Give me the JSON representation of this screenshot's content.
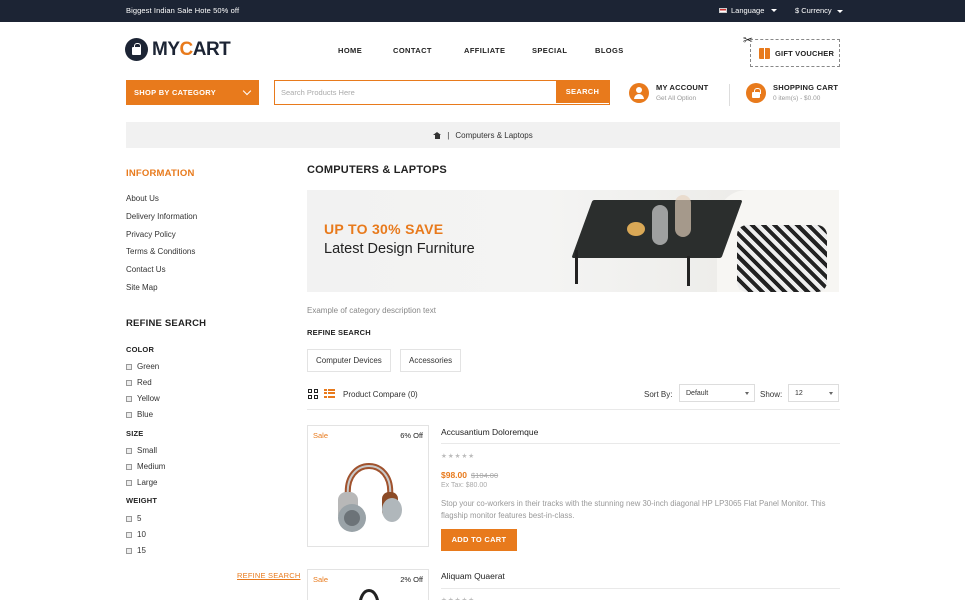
{
  "topbar": {
    "promo": "Biggest Indian Sale Hote 50% off",
    "language": "Language",
    "currency": "$ Currency"
  },
  "logo": {
    "part1": "MY",
    "part2": "C",
    "part3": "ART"
  },
  "nav": [
    "HOME",
    "CONTACT",
    "AFFILIATE",
    "SPECIAL",
    "BLOGS"
  ],
  "voucher": "GIFT VOUCHER",
  "category_button": "SHOP BY CATEGORY",
  "search": {
    "placeholder": "Search Products Here",
    "button": "SEARCH"
  },
  "account": {
    "title": "MY ACCOUNT",
    "subtitle": "Get All Option"
  },
  "cart": {
    "title": "SHOPPING CART",
    "subtitle": "0 item(s) - $0.00"
  },
  "breadcrumb": {
    "separator": "|",
    "current": "Computers & Laptops"
  },
  "sidebar": {
    "info_title": "INFORMATION",
    "info_links": [
      "About Us",
      "Delivery Information",
      "Privacy Policy",
      "Terms & Conditions",
      "Contact Us",
      "Site Map"
    ],
    "refine_title": "REFINE SEARCH",
    "color_title": "COLOR",
    "colors": [
      "Green",
      "Red",
      "Yellow",
      "Blue"
    ],
    "size_title": "SIZE",
    "sizes": [
      "Small",
      "Medium",
      "Large"
    ],
    "weight_title": "WEIGHT",
    "weights": [
      "5",
      "10",
      "15"
    ],
    "refine_link": "REFINE SEARCH"
  },
  "main": {
    "title": "COMPUTERS & LAPTOPS",
    "banner_line1": "UP TO 30% SAVE",
    "banner_line2": "Latest Design Furniture",
    "description": "Example of category description text",
    "refine_title": "REFINE SEARCH",
    "chips": [
      "Computer Devices",
      "Accessories"
    ],
    "compare": "Product Compare (0)",
    "sort_label": "Sort By:",
    "sort_value": "Default",
    "show_label": "Show:",
    "show_value": "12"
  },
  "products": [
    {
      "badge": "Sale",
      "discount": "6% Off",
      "name": "Accusantium Doloremque",
      "price": "$98.00",
      "old_price": "$104.00",
      "ex_tax": "Ex Tax: $80.00",
      "description": "Stop your co-workers in their tracks with the stunning new 30-inch diagonal HP LP3065 Flat Panel Monitor. This flagship monitor features best-in-class.",
      "button": "ADD TO CART",
      "rating": 0
    },
    {
      "badge": "Sale",
      "discount": "2% Off",
      "name": "Aliquam Quaerat"
    }
  ],
  "colors": {
    "accent": "#e87a1c",
    "dark": "#1c2434"
  }
}
